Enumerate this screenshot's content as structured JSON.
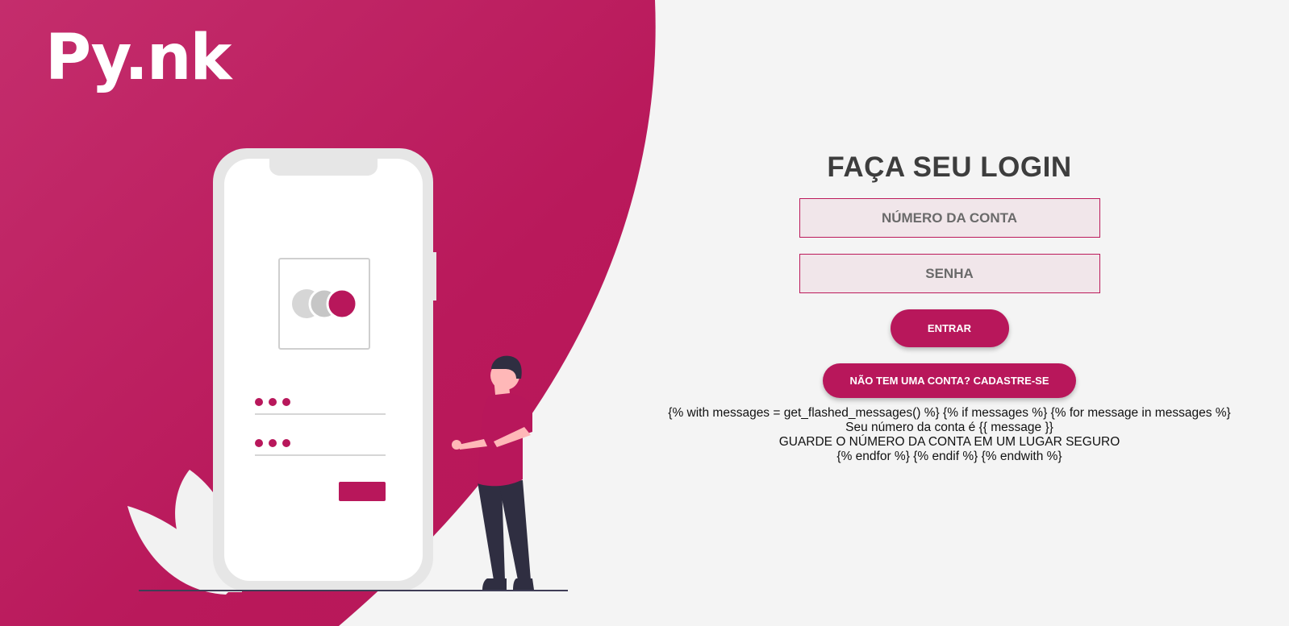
{
  "brand": {
    "logo_text": "Py.nk",
    "accent": "#b8175b",
    "panel_color": "#bc1a5b"
  },
  "login": {
    "title": "FAÇA SEU LOGIN",
    "account_placeholder": "NÚMERO DA CONTA",
    "password_placeholder": "SENHA",
    "login_button": "ENTRAR",
    "signup_button": "NÃO TEM UMA CONTA? CADASTRE-SE"
  },
  "template_text": {
    "line1": "{% with messages = get_flashed_messages() %} {% if messages %} {% for message in messages %}",
    "line2": "Seu número da conta é {{ message }}",
    "line3": "GUARDE O NÚMERO DA CONTA EM UM LUGAR SEGURO",
    "line4": "{% endfor %} {% endif %} {% endwith %}"
  },
  "illustration": {
    "name": "person-with-phone-login-illustration"
  }
}
